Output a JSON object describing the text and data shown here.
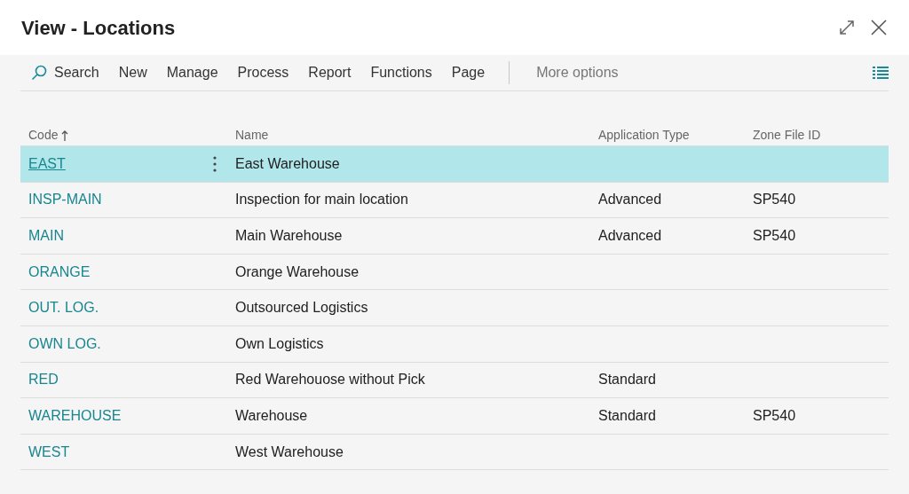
{
  "window": {
    "title": "View - Locations"
  },
  "toolbar": {
    "items": [
      "Search",
      "New",
      "Manage",
      "Process",
      "Report",
      "Functions",
      "Page"
    ],
    "more": "More options"
  },
  "table": {
    "columns": [
      {
        "label": "Code",
        "sorted": true
      },
      {
        "label": "Name",
        "sorted": false
      },
      {
        "label": "Application Type",
        "sorted": false
      },
      {
        "label": "Zone File ID",
        "sorted": false
      }
    ],
    "rows": [
      {
        "code": "EAST",
        "name": "East Warehouse",
        "application_type": "",
        "zone_file_id": "",
        "selected": true
      },
      {
        "code": "INSP-MAIN",
        "name": "Inspection for main location",
        "application_type": "Advanced",
        "zone_file_id": "SP540",
        "selected": false
      },
      {
        "code": "MAIN",
        "name": "Main Warehouse",
        "application_type": "Advanced",
        "zone_file_id": "SP540",
        "selected": false
      },
      {
        "code": "ORANGE",
        "name": "Orange Warehouse",
        "application_type": "",
        "zone_file_id": "",
        "selected": false
      },
      {
        "code": "OUT. LOG.",
        "name": "Outsourced Logistics",
        "application_type": "",
        "zone_file_id": "",
        "selected": false
      },
      {
        "code": "OWN LOG.",
        "name": "Own Logistics",
        "application_type": "",
        "zone_file_id": "",
        "selected": false
      },
      {
        "code": "RED",
        "name": "Red Warehouose without Pick",
        "application_type": "Standard",
        "zone_file_id": "",
        "selected": false
      },
      {
        "code": "WAREHOUSE",
        "name": "Warehouse",
        "application_type": "Standard",
        "zone_file_id": "SP540",
        "selected": false
      },
      {
        "code": "WEST",
        "name": "West Warehouse",
        "application_type": "",
        "zone_file_id": "",
        "selected": false
      }
    ]
  }
}
